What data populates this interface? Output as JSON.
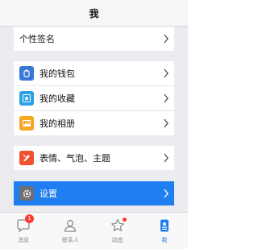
{
  "nav": {
    "title": "我"
  },
  "rows": {
    "signature": "个性签名",
    "wallet": "我的钱包",
    "favorites": "我的收藏",
    "album": "我的相册",
    "themes": "表情、气泡、主题",
    "settings": "设置"
  },
  "tabs": [
    {
      "label": "消息",
      "badge": "1",
      "icon": "chat-bubble-icon"
    },
    {
      "label": "联系人",
      "icon": "contact-person-icon"
    },
    {
      "label": "动态",
      "icon": "star-icon"
    },
    {
      "label": "我",
      "icon": "profile-card-icon"
    }
  ],
  "colors": {
    "accent": "#1f7ef0",
    "wallet_icon": "#3a78d8",
    "favorites_icon": "#2aa0e6",
    "album_icon": "#f5a623",
    "themes_icon": "#f0522f",
    "badge": "#ff3b30"
  }
}
